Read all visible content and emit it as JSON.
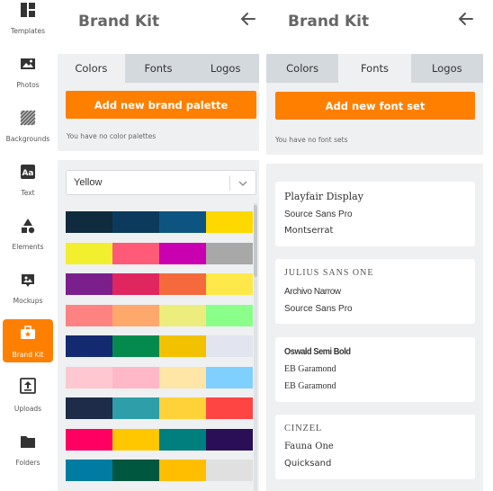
{
  "sidebar": {
    "items": [
      {
        "label": "Templates",
        "icon": "templates-icon"
      },
      {
        "label": "Photos",
        "icon": "photos-icon"
      },
      {
        "label": "Backgrounds",
        "icon": "backgrounds-icon"
      },
      {
        "label": "Text",
        "icon": "text-icon"
      },
      {
        "label": "Elements",
        "icon": "elements-icon"
      },
      {
        "label": "Mockups",
        "icon": "mockups-icon"
      },
      {
        "label": "Brand Kit",
        "icon": "brand-kit-icon",
        "active": true
      },
      {
        "label": "Uploads",
        "icon": "uploads-icon"
      },
      {
        "label": "Folders",
        "icon": "folders-icon"
      }
    ]
  },
  "colors_panel": {
    "title": "Brand Kit",
    "tabs": [
      "Colors",
      "Fonts",
      "Logos"
    ],
    "active_tab": "Colors",
    "add_button": "Add new brand palette",
    "empty_note": "You have no color palettes",
    "dropdown_value": "Yellow",
    "palettes": [
      [
        "#0f2b3d",
        "#0b3a5c",
        "#0d5580",
        "#ffd800"
      ],
      [
        "#f2f02e",
        "#ff5b79",
        "#c800b0",
        "#a8a8a8"
      ],
      [
        "#7b1f8c",
        "#e0265e",
        "#f56a3c",
        "#ffe84a"
      ],
      [
        "#ff8282",
        "#ffa86b",
        "#eded7d",
        "#8aff8a"
      ],
      [
        "#142a70",
        "#058a4e",
        "#f2c200",
        "#e2e4ef"
      ],
      [
        "#ffc7d0",
        "#ffb8c8",
        "#ffe5a6",
        "#7fd0ff"
      ],
      [
        "#1f2c47",
        "#2e9ea8",
        "#ffd23a",
        "#ff4444"
      ],
      [
        "#ff0062",
        "#ffc700",
        "#007f7f",
        "#2a0f57"
      ],
      [
        "#007ca3",
        "#00573f",
        "#ffbf00",
        "#e0e0e0"
      ]
    ]
  },
  "fonts_panel": {
    "title": "Brand Kit",
    "tabs": [
      "Colors",
      "Fonts",
      "Logos"
    ],
    "active_tab": "Fonts",
    "add_button": "Add new font set",
    "empty_note": "You have no font sets",
    "font_sets": [
      [
        "Playfair Display",
        "Source Sans Pro",
        "Montserrat"
      ],
      [
        "Julius Sans One",
        "Archivo Narrow",
        "Source Sans Pro"
      ],
      [
        "Oswald Semi Bold",
        "EB Garamond",
        "EB Garamond"
      ],
      [
        "Cinzel",
        "Fauna One",
        "Quicksand"
      ]
    ]
  }
}
